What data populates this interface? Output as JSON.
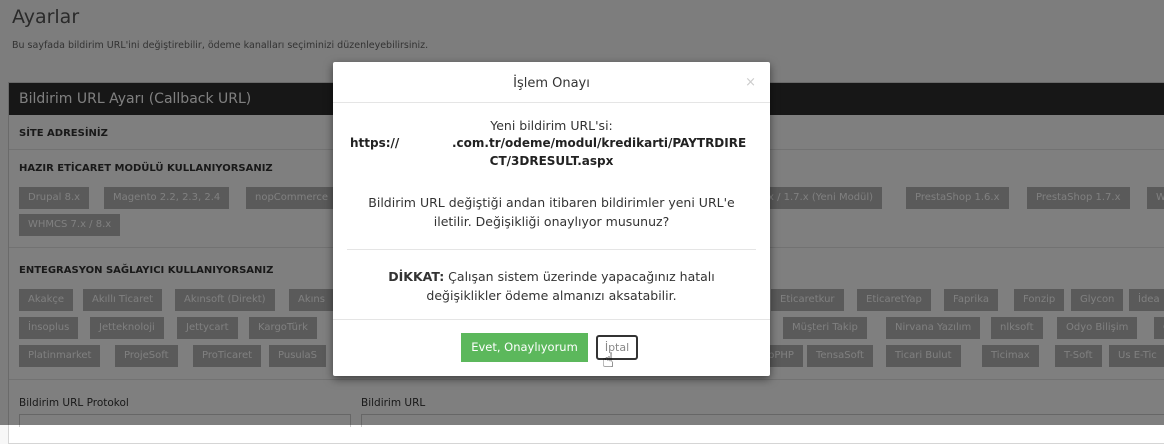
{
  "page": {
    "title": "Ayarlar",
    "description": "Bu sayfada bildirim URL'ini değiştirebilir, ödeme kanalları seçiminizi düzenleyebilirsiniz."
  },
  "panel": {
    "header": "Bildirim URL Ayarı (Callback URL)",
    "site_label": "SİTE ADRESİNİZ",
    "module_label": "HAZIR ETİCARET MODÜLÜ KULLANIYORSANIZ",
    "module_tags_row1": [
      "Drupal 8.x",
      "Magento 2.2, 2.3, 2.4",
      "nopCommerce",
      "x / 1.7.x (Yeni Modül)",
      "PrestaShop 1.6.x",
      "PrestaShop 1.7.x",
      "W"
    ],
    "module_tags_row2": [
      "WHMCS 7.x / 8.x"
    ],
    "integration_label": "ENTEGRASYON SAĞLAYICI KULLANIYORSANIZ",
    "int_row1": [
      "Akakçe",
      "Akıllı Ticaret",
      "Akınsoft (Direkt)",
      "Akıns",
      "Eticaretkur",
      "EticaretYap",
      "Faprika",
      "Fonzip",
      "Glycon",
      "İdea"
    ],
    "int_row2": [
      "İnsoplus",
      "Jetteknoloji",
      "Jettycart",
      "KargoTürk",
      "Müşteri Takip",
      "Nirvana Yazılım",
      "nlksoft",
      "Odyo Bilişim",
      "O"
    ],
    "int_row3": [
      "Platinmarket",
      "ProjeSoft",
      "ProTicaret",
      "PusulaS",
      "pPHP",
      "TensaSoft",
      "Ticari Bulut",
      "Ticimax",
      "T-Soft",
      "Us E-Tic"
    ],
    "protocol_label": "Bildirim URL Protokol",
    "url_label": "Bildirim URL"
  },
  "modal": {
    "title": "İşlem Onayı",
    "close": "×",
    "new_url_caption": "Yeni bildirim URL'si:",
    "url_prefix": "https://",
    "url_part1": ".com.tr/odeme/modul/kredikarti/PAYTRDIRE",
    "url_part2": "CT/3DRESULT.aspx",
    "info_line1": "Bildirim URL değiştiği andan itibaren bildirimler yeni URL'e",
    "info_line2": "iletilir. Değişikliği onaylıyor musunuz?",
    "warning_label": "DİKKAT:",
    "warning_line1": " Çalışan sistem üzerinde yapacağınız hatalı",
    "warning_line2": "değişiklikler ödeme almanızı aksatabilir.",
    "confirm_button": "Evet, Onaylıyorum",
    "cancel_button": "İptal"
  }
}
